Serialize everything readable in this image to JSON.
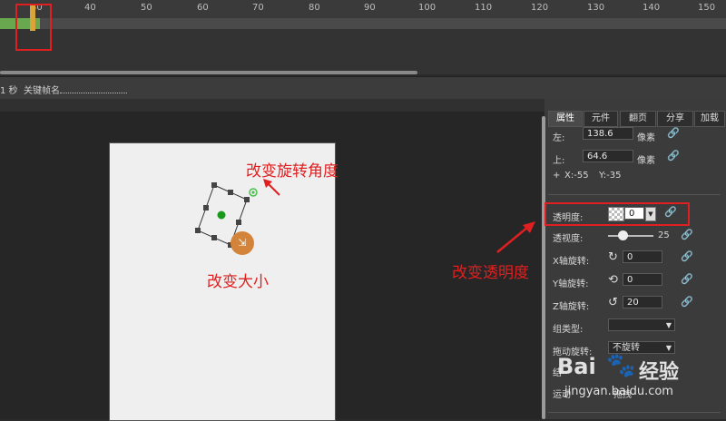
{
  "ruler": {
    "ticks": [
      "30",
      "40",
      "50",
      "60",
      "70",
      "80",
      "90",
      "100",
      "110",
      "120",
      "130",
      "140",
      "150"
    ]
  },
  "infobar": {
    "seconds": "1 秒",
    "keyframe_label": "关键帧名"
  },
  "annotations": {
    "rotate": "改变旋转角度",
    "resize": "改变大小",
    "opacity": "改变透明度"
  },
  "panel": {
    "tabs": [
      "属性",
      "元件",
      "翻页",
      "分享",
      "加载"
    ],
    "left_label": "左:",
    "left_value": "138.6",
    "left_unit": "像素",
    "top_label": "上:",
    "top_value": "64.6",
    "top_unit": "像素",
    "plus": "+",
    "x_coord": "X:-55",
    "y_coord": "Y:-35",
    "opacity_label": "透明度:",
    "opacity_value": "0",
    "perspective_label": "透视度:",
    "perspective_value": "25",
    "x_rot_label": "X轴旋转:",
    "x_rot_value": "0",
    "y_rot_label": "Y轴旋转:",
    "y_rot_value": "0",
    "z_rot_label": "Z轴旋转:",
    "z_rot_value": "20",
    "group_type_label": "组类型:",
    "auto_rot_label": "拖动旋转:",
    "auto_rot_value": "不旋转",
    "row_9_label": "结",
    "row_10_label": "运动",
    "row_10_value": "拖拽"
  },
  "watermark": {
    "brand": "Bai",
    "brand2": "经验",
    "url": "jingyan.baidu.com"
  },
  "colors": {
    "highlight": "#e02020",
    "track": "#6aa84f",
    "playhead": "#d9a43a",
    "handle": "#d4843a"
  }
}
